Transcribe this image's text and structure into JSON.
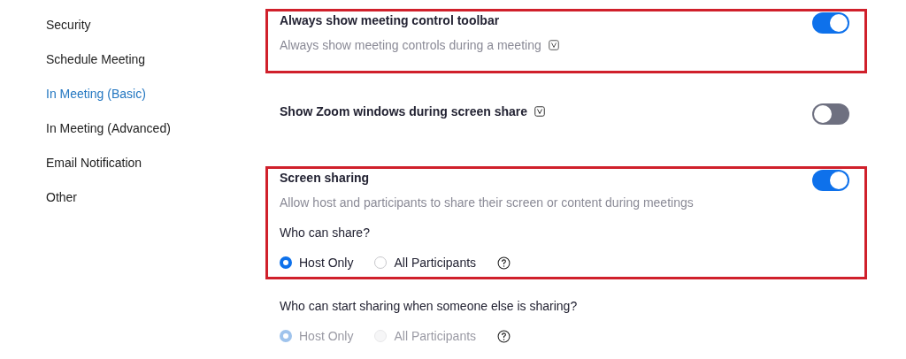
{
  "sidebar": {
    "items": [
      {
        "label": "Security",
        "selected": false
      },
      {
        "label": "Schedule Meeting",
        "selected": false
      },
      {
        "label": "In Meeting (Basic)",
        "selected": true
      },
      {
        "label": "In Meeting (Advanced)",
        "selected": false
      },
      {
        "label": "Email Notification",
        "selected": false
      },
      {
        "label": "Other",
        "selected": false
      }
    ]
  },
  "settings": [
    {
      "kind": "toggle",
      "title": "Always show meeting control toolbar",
      "description": "Always show meeting controls during a meeting",
      "description_badge": true,
      "on": true,
      "highlighted": true
    },
    {
      "kind": "toggle",
      "title": "Show Zoom windows during screen share",
      "title_badge": true,
      "on": false,
      "highlighted": false
    },
    {
      "kind": "toggle",
      "title": "Screen sharing",
      "description": "Allow host and participants to share their screen or content during meetings",
      "on": true,
      "highlighted": true,
      "question": {
        "label": "Who can share?",
        "disabled": false,
        "options": [
          {
            "label": "Host Only",
            "selected": true
          },
          {
            "label": "All Participants",
            "selected": false
          }
        ]
      }
    },
    {
      "kind": "question",
      "highlighted": false,
      "question": {
        "label": "Who can start sharing when someone else is sharing?",
        "disabled": true,
        "options": [
          {
            "label": "Host Only",
            "selected": true
          },
          {
            "label": "All Participants",
            "selected": false
          }
        ]
      }
    }
  ]
}
